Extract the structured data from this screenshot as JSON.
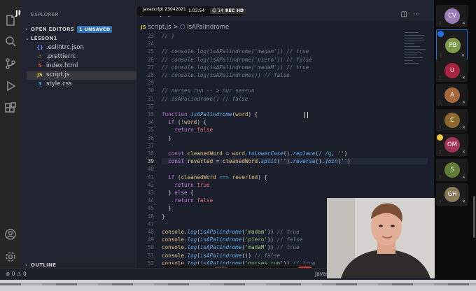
{
  "jitsi": {
    "logo": "jitsi"
  },
  "meeting": {
    "title": "Javascript 23042021",
    "time": "1:03:54",
    "count": "14",
    "rec": "REC",
    "hd": "HD"
  },
  "sidebar": {
    "title": "EXPLORER",
    "open_editors": "OPEN EDITORS",
    "unsaved": "1 UNSAVED",
    "folder": "LESSON1",
    "outline": "OUTLINE",
    "files": [
      {
        "name": ".eslintrc.json",
        "icon": "{}",
        "color": "#7a8fff"
      },
      {
        "name": ".prettierrc",
        "icon": "∴",
        "color": "#e0a33f"
      },
      {
        "name": "index.html",
        "icon": "5",
        "color": "#e44d26"
      },
      {
        "name": "script.js",
        "icon": "JS",
        "color": "#d8c548"
      },
      {
        "name": "style.css",
        "icon": "3",
        "color": "#42a5f5"
      }
    ]
  },
  "editor": {
    "tab": {
      "icon": "JS",
      "label": "script.js"
    },
    "breadcrumb": {
      "icon": "JS",
      "file": "script.js",
      "sep": ">",
      "symbol": "isAPalindrome"
    },
    "current_line": "39",
    "lines": [
      {
        "n": "23",
        "text": "// }"
      },
      {
        "n": "24",
        "text": ""
      },
      {
        "n": "25",
        "text": "// console.log(isAPalindrome('madam')) // true"
      },
      {
        "n": "26",
        "text": "// console.log(isAPalindrome('piero')) // false"
      },
      {
        "n": "27",
        "text": "// console.log(isAPalindrome('madaM')) // true"
      },
      {
        "n": "28",
        "text": "// console.log(isAPalindrome()) // false"
      },
      {
        "n": "29",
        "text": ""
      },
      {
        "n": "30",
        "text": "// nurses run -- > nur sesrun"
      },
      {
        "n": "31",
        "text": "// isAPalindrome() // false"
      },
      {
        "n": "32",
        "text": ""
      },
      {
        "n": "33",
        "text": "function isAPalindrome(word) {"
      },
      {
        "n": "34",
        "text": "  if (!word) {"
      },
      {
        "n": "35",
        "text": "    return false"
      },
      {
        "n": "36",
        "text": "  }"
      },
      {
        "n": "37",
        "text": ""
      },
      {
        "n": "38",
        "text": "  const cleanedWord = word.toLowerCase().replace(/ /g, '')"
      },
      {
        "n": "39",
        "text": "  const reverted = cleanedWord.split('').reverse().join('')"
      },
      {
        "n": "40",
        "text": ""
      },
      {
        "n": "41",
        "text": "  if (cleanedWord === reverted) {"
      },
      {
        "n": "42",
        "text": "    return true"
      },
      {
        "n": "43",
        "text": "  } else {"
      },
      {
        "n": "44",
        "text": "    return false"
      },
      {
        "n": "45",
        "text": "  }"
      },
      {
        "n": "46",
        "text": "}"
      },
      {
        "n": "47",
        "text": ""
      },
      {
        "n": "48",
        "text": "console.log(isAPalindrome('madam')) // true"
      },
      {
        "n": "49",
        "text": "console.log(isAPalindrome('piero')) // false"
      },
      {
        "n": "50",
        "text": "console.log(isAPalindrome('madaM')) // true"
      },
      {
        "n": "51",
        "text": "console.log(isAPalindrome()) // false"
      },
      {
        "n": "52",
        "text": "console.log(isAPalindrome('nurses run')) // true"
      }
    ]
  },
  "participants": [
    {
      "initials": "CV",
      "color": "#9c7ab8",
      "active": false
    },
    {
      "initials": "PB",
      "color": "#7e9a4a",
      "active": true
    },
    {
      "initials": "U",
      "color": "#a8233f",
      "active": false
    },
    {
      "initials": "A",
      "color": "#a4683a",
      "active": false
    },
    {
      "initials": "C",
      "color": "#8c6a2e",
      "active": false
    },
    {
      "initials": "OM",
      "color": "#a03558",
      "active": false
    },
    {
      "initials": "S",
      "color": "#5f7d36",
      "active": false
    },
    {
      "initials": "GH",
      "color": "#8a7a58",
      "active": false
    }
  ],
  "statusbar": {
    "errors": "0",
    "warnings": "0",
    "lang": "Javas"
  }
}
